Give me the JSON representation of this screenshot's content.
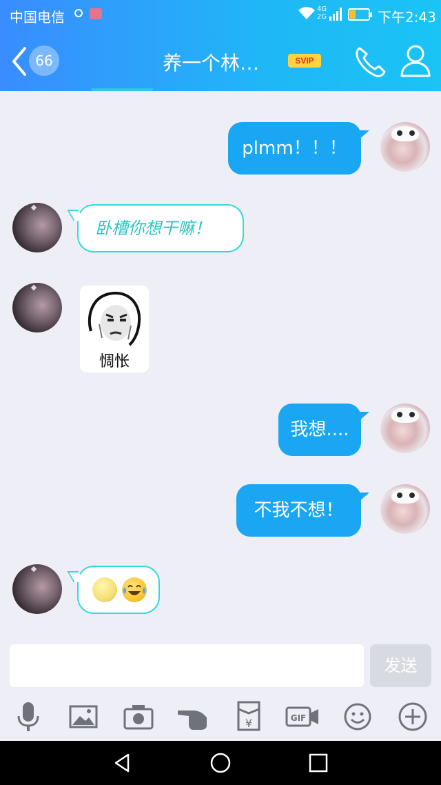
{
  "status_bar": {
    "carrier": "中国电信",
    "network_top": "4G",
    "network_bottom": "2G",
    "time": "下午2:43",
    "battery_level": 0.3
  },
  "header": {
    "back_icon": "chevron-left-icon",
    "unread_count": "66",
    "contact_name": "养一个林…",
    "vip_badge": "SVIP",
    "call_icon": "phone-icon",
    "profile_icon": "person-icon"
  },
  "messages": [
    {
      "side": "out",
      "type": "text",
      "text": "plmm！！！"
    },
    {
      "side": "in",
      "type": "text",
      "text": "卧槽你想干嘛！"
    },
    {
      "side": "in",
      "type": "sticker",
      "caption": "惆怅"
    },
    {
      "side": "out",
      "type": "text",
      "text": "我想...."
    },
    {
      "side": "out",
      "type": "text",
      "text": "不我不想！"
    },
    {
      "side": "in",
      "type": "emoji",
      "emojis": [
        "full-moon-face-icon",
        "tears-of-joy-icon"
      ]
    }
  ],
  "composer": {
    "input_value": "",
    "send_label": "发送"
  },
  "toolbar": [
    "microphone-icon",
    "image-icon",
    "camera-icon",
    "hand-icon",
    "red-packet-icon",
    "gif-icon",
    "emoji-icon",
    "plus-icon"
  ],
  "colors": {
    "header_gradient_start": "#3a8cff",
    "header_gradient_end": "#1ac4f5",
    "bubble_out": "#19a6f2",
    "bubble_in_border": "#35d9dd",
    "background": "#eeeff6"
  }
}
